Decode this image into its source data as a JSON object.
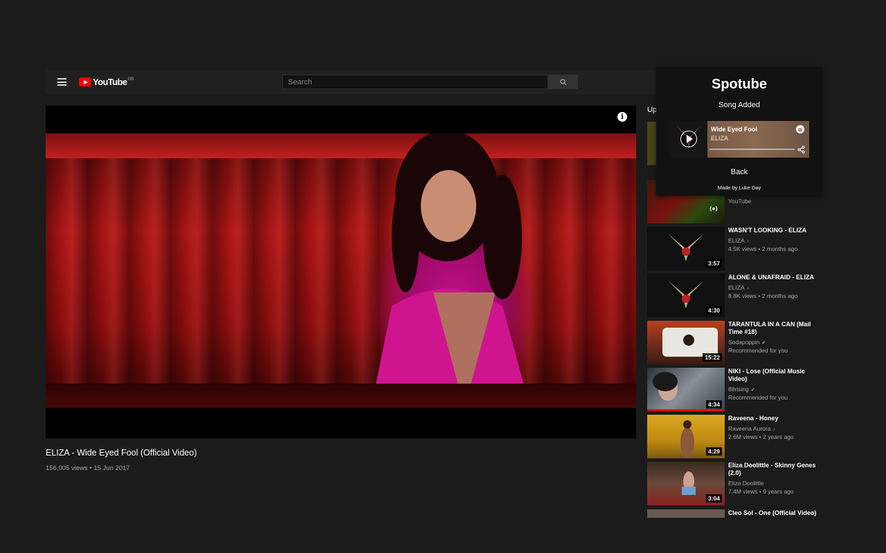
{
  "header": {
    "logo_text": "YouTube",
    "region": "GB",
    "search_placeholder": "Search"
  },
  "video": {
    "title": "ELIZA - Wide Eyed Fool (Official Video)",
    "meta": "156,005 views • 15 Jun 2017"
  },
  "sidebar": {
    "up_next_label": "Up",
    "items": [
      {
        "title": "",
        "channel": "YouTube",
        "meta": "",
        "duration": ""
      },
      {
        "title": "WASN'T LOOKING - ELIZA",
        "channel": "ELIZA",
        "meta": "4.5K views • 2 months ago",
        "duration": "3:57"
      },
      {
        "title": "ALONE & UNAFRAID - ELIZA",
        "channel": "ELIZA",
        "meta": "8.8K views • 2 months ago",
        "duration": "4:30"
      },
      {
        "title": "TARANTULA IN A CAN (Mail Time #18)",
        "channel": "Sodapoppin",
        "meta": "Recommended for you",
        "duration": "15:22"
      },
      {
        "title": "NIKI - Lose (Official Music Video)",
        "channel": "88rising",
        "meta": "Recommended for you",
        "duration": "4:34"
      },
      {
        "title": "Raveena - Honey",
        "channel": "Raveena Aurora",
        "meta": "2.6M views • 2 years ago",
        "duration": "4:29"
      },
      {
        "title": "Eliza Doolittle - Skinny Genes (2.0)",
        "channel": "Eliza Doolittle",
        "meta": "7.4M views • 9 years ago",
        "duration": "3:04"
      },
      {
        "title": "Cleo Sol - One (Official Video)",
        "channel": "",
        "meta": "",
        "duration": ""
      }
    ]
  },
  "spotube": {
    "title": "Spotube",
    "status": "Song Added",
    "song": "Wide Eyed Fool",
    "artist": "ELIZA",
    "back_label": "Back",
    "credit": "Made by Luke Day"
  },
  "colors": {
    "background": "#1b1b1b",
    "accent_red": "#ff0000",
    "popup_bg": "#121212"
  }
}
